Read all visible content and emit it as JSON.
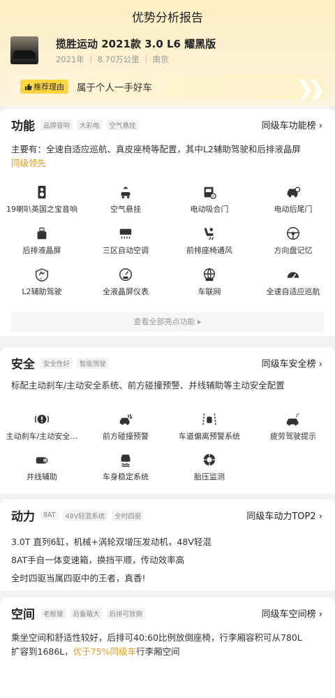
{
  "header": {
    "title": "优势分析报告"
  },
  "car": {
    "name": "揽胜运动 2021款 3.0 L6 耀黑版",
    "meta": "2021年 ｜ 8.70万公里 ｜ 南京"
  },
  "reason": {
    "badge": "推荐理由",
    "text": "属于个人一手好车"
  },
  "feature": {
    "title": "功能",
    "tags": [
      "品牌音响",
      "大彩电",
      "空气悬挂"
    ],
    "rank": "同级车功能榜",
    "summary": "主要有：全速自适应巡航、真皮座椅等配置，其中L2辅助驾驶和后排液晶屏",
    "highlight": "同级领先",
    "items": [
      "19喇叭英国之宝音响",
      "空气悬挂",
      "电动吸合门",
      "电动后尾门",
      "后排液晶屏",
      "三区自动空调",
      "前排座椅通风",
      "方向盘记忆",
      "L2辅助驾驶",
      "全液晶屏仪表",
      "车联网",
      "全速自适应巡航"
    ],
    "icons": [
      "speaker-icon",
      "air-suspension-icon",
      "car-door-icon",
      "tailgate-icon",
      "rear-screen-icon",
      "air-conditioner-icon",
      "seat-ventilation-icon",
      "steering-memory-icon",
      "l2-assist-icon",
      "lcd-dashboard-icon",
      "connected-car-icon",
      "adaptive-cruise-icon"
    ],
    "more": "查看全部亮点功能 ▸"
  },
  "safety": {
    "title": "安全",
    "tags": [
      "安全性好",
      "智能驾驶"
    ],
    "rank": "同级车安全榜",
    "summary": "标配主动刹车/主动安全系统、前方碰撞预警、并线辅助等主动安全配置",
    "items": [
      "主动刹车/主动安全…",
      "前方碰撞预警",
      "车道偏离预警系统",
      "疲劳驾驶提示",
      "并线辅助",
      "车身稳定系统",
      "胎压监测"
    ],
    "icons": [
      "active-brake-icon",
      "collision-warning-icon",
      "lane-departure-icon",
      "fatigue-alert-icon",
      "blind-spot-icon",
      "stability-control-icon",
      "tire-pressure-icon"
    ]
  },
  "power": {
    "title": "动力",
    "tags": [
      "8AT",
      "48V轻混系统",
      "全时四驱"
    ],
    "rank": "同级车动力TOP2",
    "lines": [
      "3.0T 直列6缸，机械+涡轮双增压发动机，48V轻混",
      "8AT手自一体变速箱，换挡平顺，传动效率高",
      "全时四驱当属四驱中的王者，真香!"
    ]
  },
  "space": {
    "title": "空间",
    "tags": [
      "老板键",
      "后备箱大",
      "后排可放倒"
    ],
    "rank": "同级车空间榜",
    "text1": "乘坐空间和舒适性较好，后排可40:60比例放倒座椅，行李厢容积可从780L",
    "text2a": "扩容到1686L，",
    "text2b": "优于75%同级车",
    "text2c": "行李厢空间"
  },
  "colors": {
    "accent": "#e39b12",
    "badge": "#ffd43d"
  }
}
